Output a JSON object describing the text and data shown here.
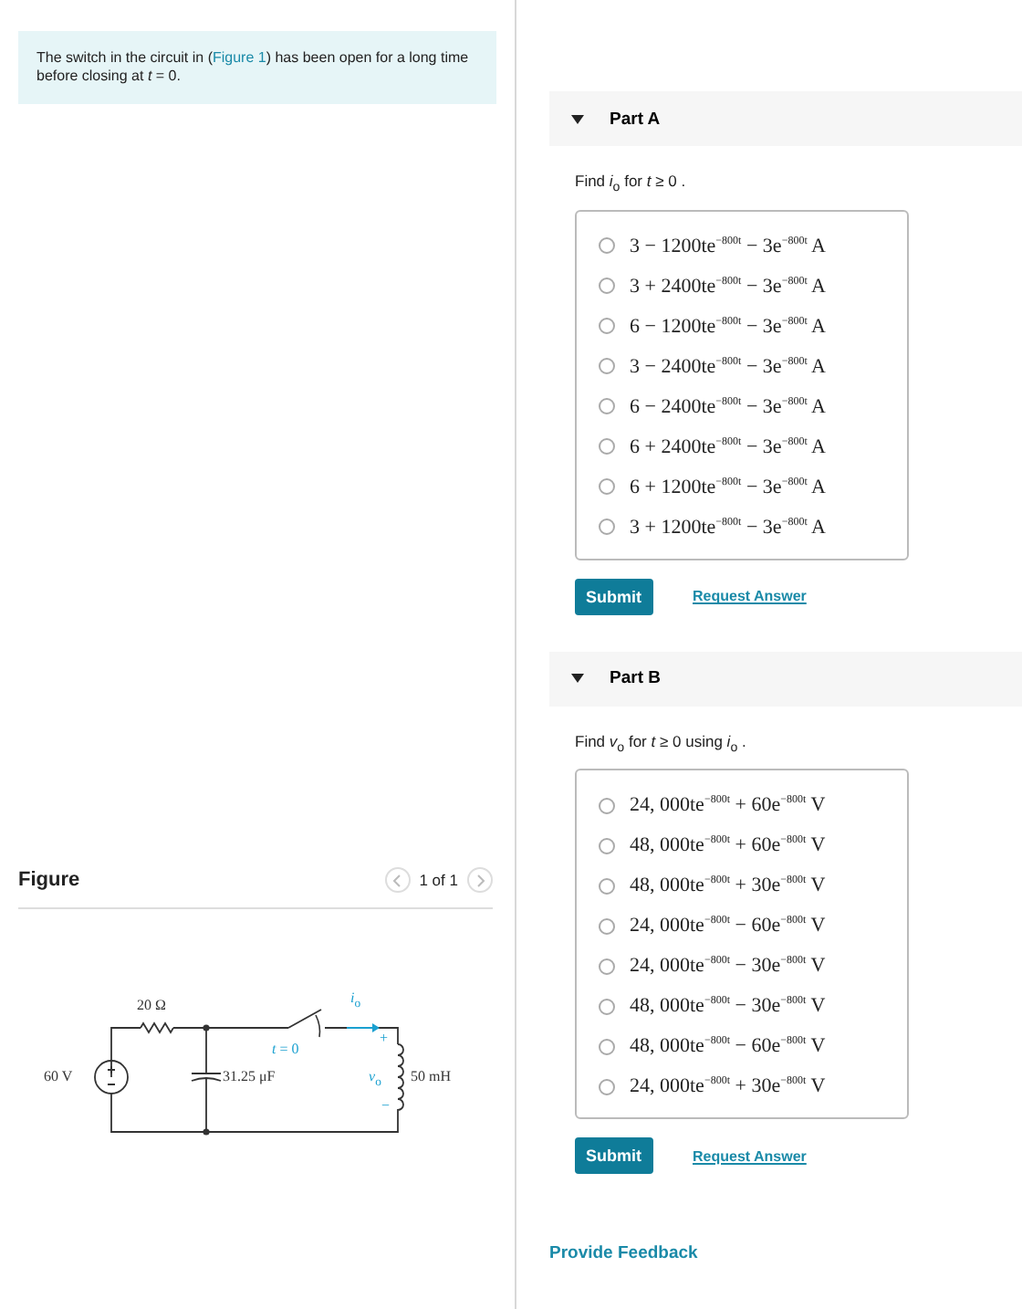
{
  "problem": {
    "text_before": "The switch in the circuit in (",
    "link": "Figure 1",
    "text_after": ") has been open for a long time before closing at *t* = 0."
  },
  "figure": {
    "title": "Figure",
    "pager": "1 of 1",
    "labels": {
      "resistor": "20 Ω",
      "source": "60 V",
      "capacitor": "31.25 μF",
      "switch": "*t* = 0",
      "current": "*i*$_{o}$",
      "plus": "+",
      "voltage": "*v*$_{o}$",
      "minus": "−",
      "inductor": "50 mH"
    }
  },
  "parts": [
    {
      "title": "Part A",
      "expanded": true,
      "prompt": "Find *i*$_{o}$  for *t* ≥ 0 .",
      "options": [
        {
          "text": "3 − 1200te$^{−800t}$ − 3e$^{−800t}$ A",
          "selected": false
        },
        {
          "text": "3 + 2400te$^{−800t}$ − 3e$^{−800t}$ A",
          "selected": false
        },
        {
          "text": "6 − 1200te$^{−800t}$ − 3e$^{−800t}$ A",
          "selected": false
        },
        {
          "text": "3 − 2400te$^{−800t}$ − 3e$^{−800t}$ A",
          "selected": false
        },
        {
          "text": "6 − 2400te$^{−800t}$ − 3e$^{−800t}$ A",
          "selected": false
        },
        {
          "text": "6 + 2400te$^{−800t}$ − 3e$^{−800t}$ A",
          "selected": false
        },
        {
          "text": "6 + 1200te$^{−800t}$ − 3e$^{−800t}$ A",
          "selected": false
        },
        {
          "text": "3 + 1200te$^{−800t}$ − 3e$^{−800t}$ A",
          "selected": false
        }
      ],
      "submit": "Submit",
      "request": "Request Answer"
    },
    {
      "title": "Part B",
      "expanded": true,
      "prompt": "Find *v*$_{o}$  for *t* ≥ 0  using *i*$_{o}$ .",
      "options": [
        {
          "text": "24, 000te$^{−800t}$ + 60e$^{−800t}$ V",
          "selected": false
        },
        {
          "text": "48, 000te$^{−800t}$ + 60e$^{−800t}$ V",
          "selected": false
        },
        {
          "text": "48, 000te$^{−800t}$ + 30e$^{−800t}$ V",
          "selected": false
        },
        {
          "text": "24, 000te$^{−800t}$ − 60e$^{−800t}$ V",
          "selected": false
        },
        {
          "text": "24, 000te$^{−800t}$ − 30e$^{−800t}$ V",
          "selected": false
        },
        {
          "text": "48, 000te$^{−800t}$ − 30e$^{−800t}$ V",
          "selected": false
        },
        {
          "text": "48, 000te$^{−800t}$ − 60e$^{−800t}$ V",
          "selected": false
        },
        {
          "text": "24, 000te$^{−800t}$ + 30e$^{−800t}$ V",
          "selected": false
        }
      ],
      "submit": "Submit",
      "request": "Request Answer"
    }
  ],
  "feedback": "Provide Feedback"
}
